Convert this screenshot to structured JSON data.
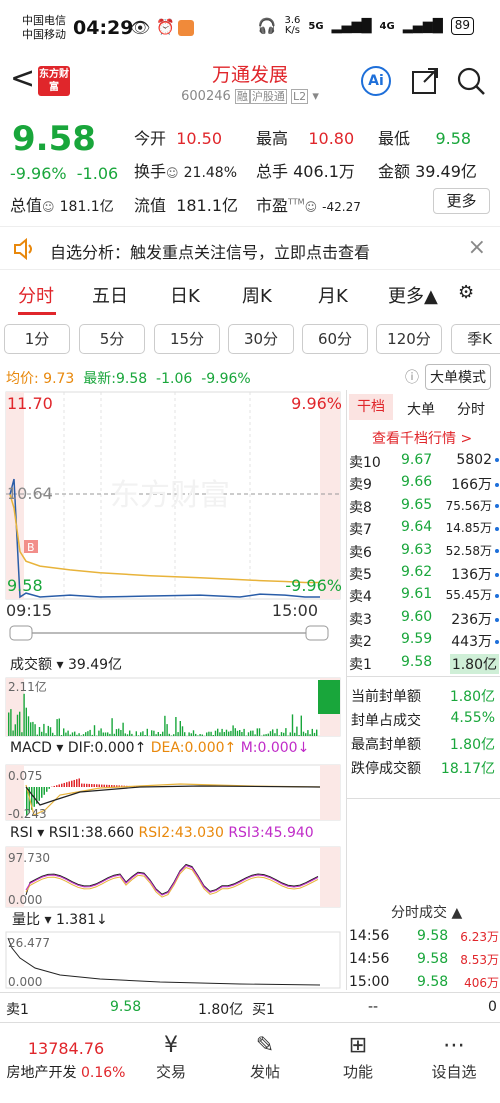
{
  "status": {
    "carrier1": "中国电信",
    "carrier2": "中国移动",
    "time": "04:29",
    "speed": "3.6",
    "speed_unit": "K/s",
    "net1": "5G",
    "net2": "4G",
    "battery": "89"
  },
  "header": {
    "back": "<",
    "logo": "东方财富",
    "title": "万通发展",
    "code": "600246",
    "tag1": "融",
    "tag2": "沪股通",
    "tag3": "L2",
    "ai": "Ai"
  },
  "quote": {
    "price": "9.58",
    "pct": "-9.96%",
    "chg": "-1.06",
    "open_label": "今开",
    "open": "10.50",
    "high_label": "最高",
    "high": "10.80",
    "low_label": "最低",
    "low": "9.58",
    "turn_label": "换手",
    "turn": "21.48%",
    "vol_label": "总手",
    "vol": "406.1万",
    "amt_label": "金额",
    "amt": "39.49亿",
    "mcap_label": "总值",
    "mcap": "181.1亿",
    "fcap_label": "流值",
    "fcap": "181.1亿",
    "pe_label": "市盈",
    "pe_sup": "TTM",
    "pe": "-42.27",
    "more": "更多"
  },
  "notice": {
    "text": "自选分析：触发重点关注信号，立即点击查看",
    "close": "×"
  },
  "tabs": [
    "分时",
    "五日",
    "日K",
    "周K",
    "月K",
    "更多▲"
  ],
  "intervals": [
    "1分",
    "5分",
    "15分",
    "30分",
    "60分",
    "120分",
    "季K"
  ],
  "avg": {
    "avg_label": "均价:",
    "avg": "9.73",
    "latest_label": "最新:",
    "latest": "9.58",
    "chg": "-1.06",
    "pct": "-9.96%",
    "bigorder": "大单模式"
  },
  "chart": {
    "y_top": "11.70",
    "y_mid": "10.64",
    "y_bot": "9.58",
    "pct_top": "9.96%",
    "pct_bot": "-9.96%",
    "t_start": "09:15",
    "t_end": "15:00",
    "marker": "B",
    "vol_label": "成交额",
    "vol_value": "39.49亿",
    "vol_max": "2.11亿",
    "macd_label": "MACD",
    "dif": "DIF:0.000↑",
    "dea": "DEA:0.000↑",
    "m": "M:0.000↓",
    "macd_top": "0.075",
    "macd_bot": "-0.243",
    "rsi_label": "RSI",
    "rsi1": "RSI1:38.660",
    "rsi2": "RSI2:43.030",
    "rsi3": "RSI3:45.940",
    "rsi_top": "97.730",
    "rsi_bot": "0.000",
    "lb_label": "量比",
    "lb_value": "1.381↓",
    "lb_top": "26.477",
    "lb_bot": "0.000"
  },
  "chart_data": {
    "type": "line",
    "title": "",
    "price_range": [
      9.58,
      11.7
    ],
    "x": [
      "09:15",
      "09:30",
      "09:32",
      "09:35",
      "09:40",
      "09:50",
      "10:00",
      "10:30",
      "11:00",
      "11:30",
      "13:30",
      "14:00",
      "14:30",
      "15:00"
    ],
    "series": [
      {
        "name": "价格",
        "values": [
          10.64,
          10.8,
          9.58,
          9.62,
          9.58,
          9.6,
          9.58,
          9.59,
          9.6,
          9.58,
          9.61,
          9.6,
          9.58,
          9.58
        ]
      },
      {
        "name": "均价",
        "values": [
          10.64,
          10.5,
          10.05,
          9.95,
          9.9,
          9.86,
          9.83,
          9.8,
          9.78,
          9.76,
          9.75,
          9.74,
          9.73,
          9.73
        ]
      }
    ]
  },
  "panel": {
    "tab1": "干档",
    "tab2": "大单",
    "tab3": "分时",
    "link": "查看千档行情 >",
    "asks": [
      {
        "l": "卖10",
        "p": "9.67",
        "v": "5802"
      },
      {
        "l": "卖9",
        "p": "9.66",
        "v": "166万"
      },
      {
        "l": "卖8",
        "p": "9.65",
        "v": "75.56万"
      },
      {
        "l": "卖7",
        "p": "9.64",
        "v": "14.85万"
      },
      {
        "l": "卖6",
        "p": "9.63",
        "v": "52.58万"
      },
      {
        "l": "卖5",
        "p": "9.62",
        "v": "136万"
      },
      {
        "l": "卖4",
        "p": "9.61",
        "v": "55.45万"
      },
      {
        "l": "卖3",
        "p": "9.60",
        "v": "236万"
      },
      {
        "l": "卖2",
        "p": "9.59",
        "v": "443万"
      },
      {
        "l": "卖1",
        "p": "9.58",
        "v": "1.80亿"
      }
    ],
    "stats": [
      {
        "k": "当前封单额",
        "v": "1.80亿"
      },
      {
        "k": "封单占成交",
        "v": "4.55%"
      },
      {
        "k": "最高封单额",
        "v": "1.80亿"
      },
      {
        "k": "跌停成交额",
        "v": "18.17亿"
      }
    ],
    "ticks_title": "分时成交 ▲",
    "ticks": [
      {
        "t": "14:56",
        "p": "9.58",
        "v": "6.23万"
      },
      {
        "t": "14:56",
        "p": "9.58",
        "v": "8.53万"
      },
      {
        "t": "15:00",
        "p": "9.58",
        "v": "406万"
      }
    ]
  },
  "bottom": {
    "sell1": "卖1",
    "sell1_p": "9.58",
    "sell1_v": "1.80亿",
    "buy1": "买1",
    "buy1_p": "--",
    "buy1_v": "0"
  },
  "nav": {
    "idx_value": "13784.76",
    "idx_name": "房地产开发",
    "idx_pct": "0.16%",
    "items": [
      "交易",
      "发帖",
      "功能",
      "设自选"
    ]
  },
  "colors": {
    "up": "#E0262B",
    "down": "#19A63B",
    "avg": "#E8B33A",
    "price_line": "#2A5DA8"
  }
}
